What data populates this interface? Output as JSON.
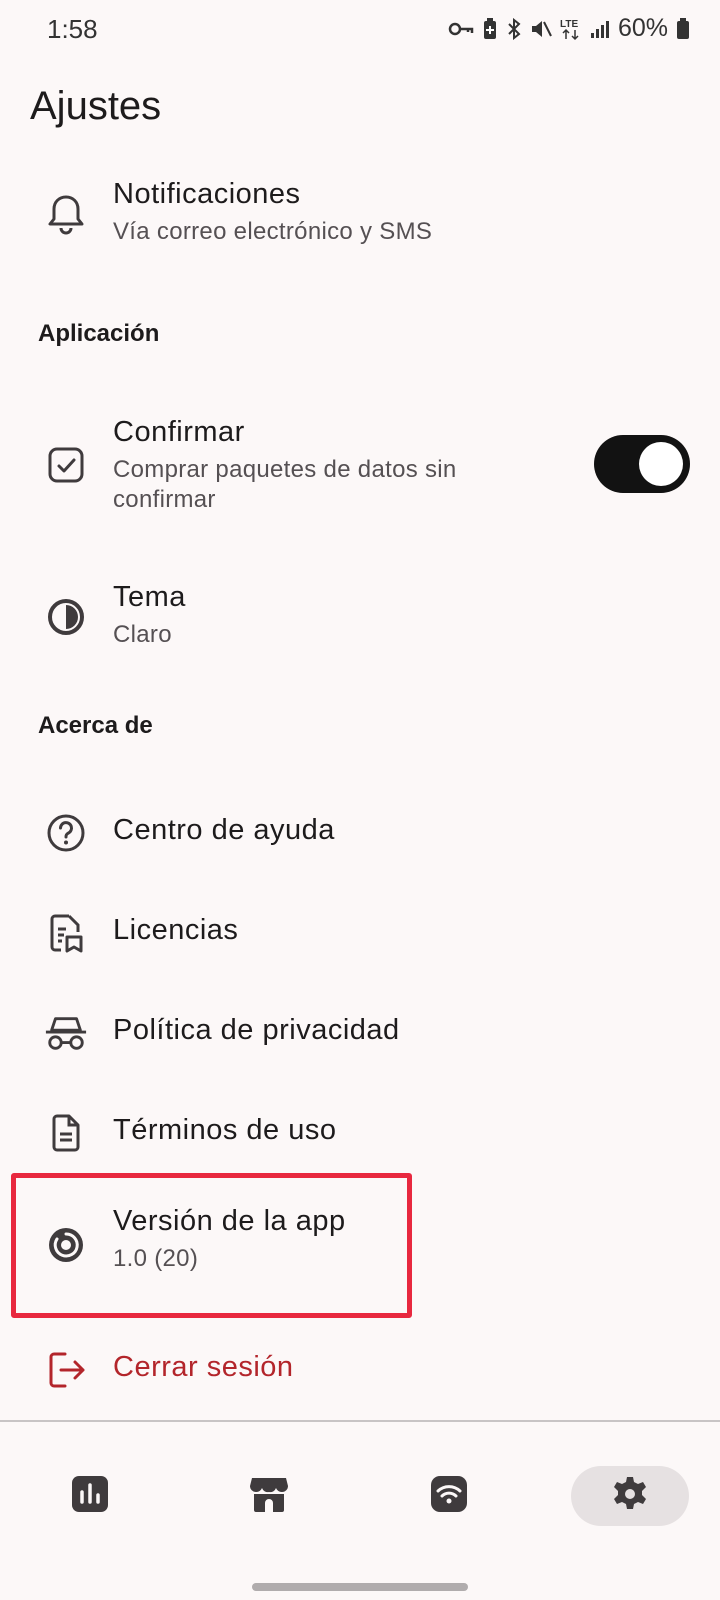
{
  "status_bar": {
    "time": "1:58",
    "icons": [
      "vpn-key-icon",
      "battery-saver-icon",
      "bluetooth-icon",
      "vibrate-mute-icon",
      "lte-icon",
      "signal-icon"
    ],
    "battery_percent": "60%"
  },
  "page": {
    "title": "Ajustes"
  },
  "items": {
    "notifications": {
      "title": "Notificaciones",
      "subtitle": "Vía correo electrónico y SMS",
      "icon": "bell-icon"
    },
    "section_app": "Aplicación",
    "confirm": {
      "title": "Confirmar",
      "subtitle": "Comprar paquetes de datos sin confirmar",
      "toggle_on": true,
      "icon": "checkbox-icon"
    },
    "theme": {
      "title": "Tema",
      "subtitle": "Claro",
      "icon": "contrast-icon"
    },
    "section_about": "Acerca de",
    "help": {
      "title": "Centro de ayuda",
      "icon": "help-circle-icon"
    },
    "licenses": {
      "title": "Licencias",
      "icon": "license-document-icon"
    },
    "privacy": {
      "title": "Política de privacidad",
      "icon": "incognito-icon"
    },
    "terms": {
      "title": "Términos de uso",
      "icon": "document-icon"
    },
    "version": {
      "title": "Versión de la app",
      "subtitle": "1.0 (20)",
      "icon": "version-icon"
    },
    "logout": {
      "title": "Cerrar sesión",
      "icon": "logout-icon",
      "color": "#b3252b"
    }
  },
  "bottom_nav": [
    {
      "icon": "chart-icon",
      "active": false
    },
    {
      "icon": "store-icon",
      "active": false
    },
    {
      "icon": "wifi-icon",
      "active": false
    },
    {
      "icon": "gear-icon",
      "active": true
    }
  ],
  "colors": {
    "background": "#fcf8f8",
    "highlight_border": "#e8283f",
    "toggle_track": "#121212",
    "logout_red": "#b3252b"
  }
}
